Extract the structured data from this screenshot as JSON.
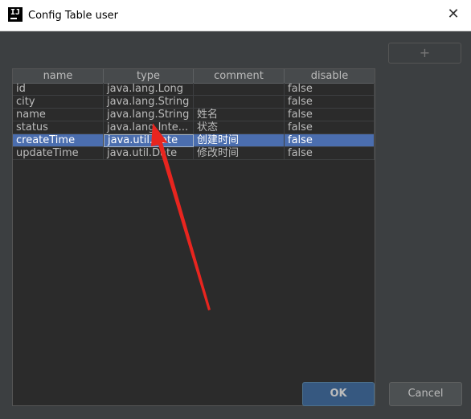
{
  "window": {
    "title": "Config Table user",
    "app_icon": "intellij-icon",
    "close_glyph": "✕"
  },
  "table": {
    "columns": [
      "name",
      "type",
      "comment",
      "disable"
    ],
    "rows": [
      [
        "id",
        "java.lang.Long",
        "",
        "false"
      ],
      [
        "city",
        "java.lang.String",
        "",
        "false"
      ],
      [
        "name",
        "java.lang.String",
        "姓名",
        "false"
      ],
      [
        "status",
        "java.lang.Inte...",
        "状态",
        "false"
      ],
      [
        "createTime",
        "java.util.Date",
        "创建时间",
        "false"
      ],
      [
        "updateTime",
        "java.util.Date",
        "修改时间",
        "false"
      ]
    ],
    "selected_row_index": 4
  },
  "buttons": {
    "add_label": "+",
    "ok_label": "OK",
    "cancel_label": "Cancel"
  },
  "colors": {
    "accent_selection": "#4b6eaf",
    "ok_button": "#365880",
    "annotation_arrow": "#e8251f"
  }
}
